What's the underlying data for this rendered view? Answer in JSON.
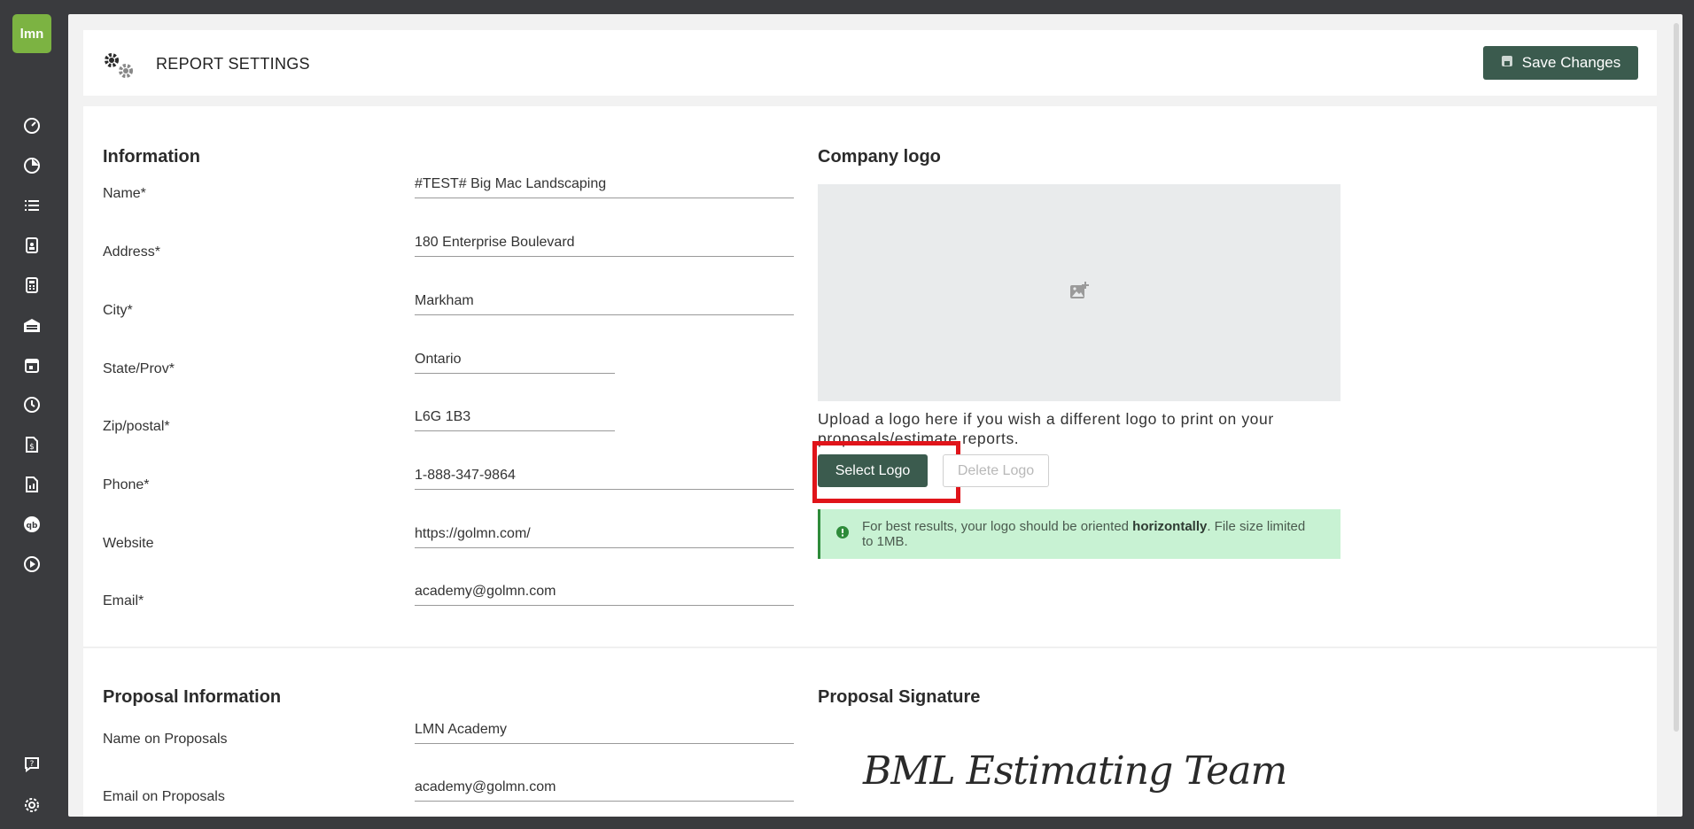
{
  "app": {
    "logo_text": "lmn"
  },
  "sidebar": {
    "icons": [
      "dashboard-icon",
      "pie-chart-icon",
      "list-icon",
      "clipboard-user-icon",
      "calculator-icon",
      "warehouse-icon",
      "calendar-icon",
      "clock-icon",
      "dollar-file-icon",
      "report-file-icon",
      "quickbooks-icon",
      "play-icon"
    ],
    "bottom_icons": [
      "help-chat-icon",
      "settings-gear-icon"
    ]
  },
  "header": {
    "title": "REPORT SETTINGS",
    "save_label": "Save Changes"
  },
  "information": {
    "title": "Information",
    "fields": [
      {
        "label": "Name*",
        "value": "#TEST# Big Mac Landscaping"
      },
      {
        "label": "Address*",
        "value": "180 Enterprise Boulevard"
      },
      {
        "label": "City*",
        "value": "Markham"
      },
      {
        "label": "State/Prov*",
        "value": "Ontario"
      },
      {
        "label": "Zip/postal*",
        "value": "L6G 1B3"
      },
      {
        "label": "Phone*",
        "value": "1-888-347-9864"
      },
      {
        "label": "Website",
        "value": "https://golmn.com/"
      },
      {
        "label": "Email*",
        "value": "academy@golmn.com"
      }
    ]
  },
  "company_logo": {
    "title": "Company logo",
    "upload_text": "Upload a logo here if you wish a different logo to print on your proposals/estimate reports.",
    "select_label": "Select Logo",
    "delete_label": "Delete Logo",
    "info_prefix": "For best results, your logo should be oriented ",
    "info_bold": "horizontally",
    "info_suffix": ". File size limited to 1MB."
  },
  "proposal_information": {
    "title": "Proposal Information",
    "fields": [
      {
        "label": "Name on Proposals",
        "value": "LMN Academy"
      },
      {
        "label": "Email on Proposals",
        "value": "academy@golmn.com"
      }
    ]
  },
  "proposal_signature": {
    "title": "Proposal Signature",
    "signature_text": "BML Estimating Team"
  },
  "colors": {
    "accent": "#3b5b4e",
    "brand": "#7cb342",
    "info_bg": "#c8f2d3",
    "highlight": "#e0141a"
  }
}
